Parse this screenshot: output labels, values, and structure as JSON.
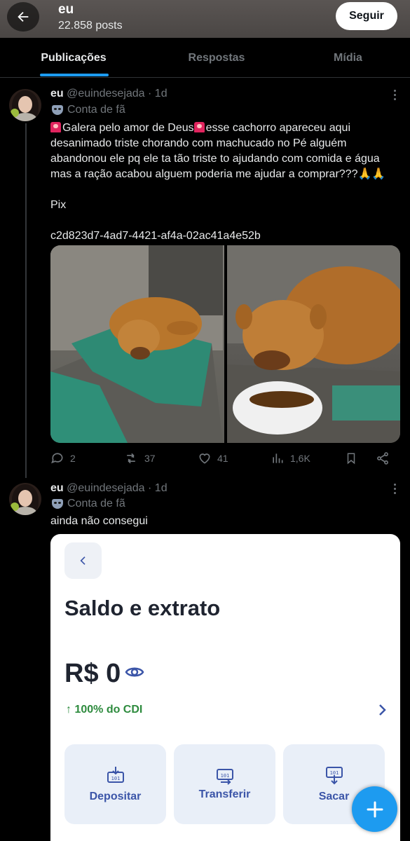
{
  "header": {
    "name": "eu",
    "posts": "22.858 posts",
    "follow_label": "Seguir"
  },
  "tabs": [
    {
      "label": "Publicações",
      "active": true
    },
    {
      "label": "Respostas",
      "active": false
    },
    {
      "label": "Mídia",
      "active": false
    }
  ],
  "posts": [
    {
      "name": "eu",
      "handle": "@euindesejada",
      "time": "1d",
      "badge": "Conta de fã",
      "text_line1_a": "Galera pelo amor de Deus",
      "text_line1_b": "esse cachorro apareceu aqui",
      "text_rest": "desanimado triste chorando com machucado no Pé alguém\nabandonou ele pq ele ta tão triste to ajudando com comida e água\nmas a ração acabou alguem poderia me ajudar a comprar???🙏🙏\n\nPix\n\nc2d823d7-4ad7-4421-af4a-02ac41a4e52b",
      "stats": {
        "replies": "2",
        "reposts": "37",
        "likes": "41",
        "views": "1,6K"
      }
    },
    {
      "name": "eu",
      "handle": "@euindesejada",
      "time": "1d",
      "badge": "Conta de fã",
      "text": "ainda não consegui"
    }
  ],
  "bank_screen": {
    "title": "Saldo e extrato",
    "balance": "R$ 0",
    "cdi": "↑ 100% do CDI",
    "buttons": [
      {
        "label": "Depositar"
      },
      {
        "label": "Transferir"
      },
      {
        "label": "Sacar"
      }
    ],
    "accent": "#3b55a8"
  },
  "colors": {
    "accent": "#1d9bf0",
    "muted": "#71767b",
    "text": "#e7e9ea"
  }
}
